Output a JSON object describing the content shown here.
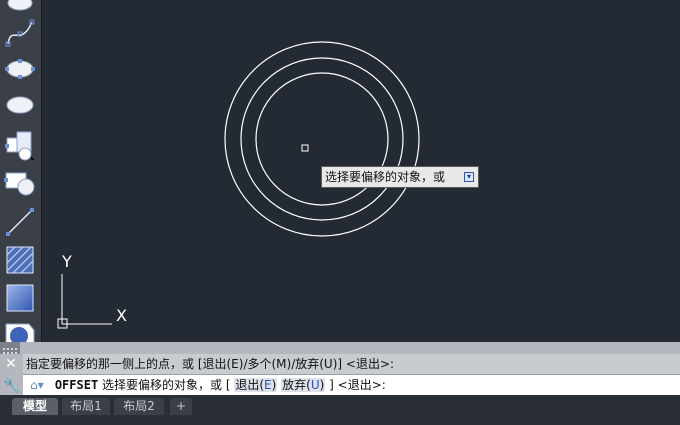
{
  "toolbar": {
    "tools": [
      {
        "name": "ellipse-icon"
      },
      {
        "name": "spline-icon"
      },
      {
        "name": "ellipse-grips-icon"
      },
      {
        "name": "ellipse-icon"
      },
      {
        "name": "region-icon"
      },
      {
        "name": "rectangle-circle-icon"
      },
      {
        "name": "line-icon"
      },
      {
        "name": "hatch-icon"
      },
      {
        "name": "gradient-icon"
      },
      {
        "name": "boundary-icon"
      }
    ]
  },
  "canvas": {
    "ucs": {
      "y_label": "Y",
      "x_label": "X"
    },
    "colors": {
      "background": "#242a33",
      "geometry": "#ffffff"
    }
  },
  "tooltip": {
    "text": "选择要偏移的对象，或",
    "icon": "expand-down-icon"
  },
  "command": {
    "history": "指定要偏移的那一侧上的点，或 [退出(E)/多个(M)/放弃(U)] <退出>:",
    "current": {
      "name": "OFFSET",
      "prompt": "选择要偏移的对象，或 [",
      "options": [
        {
          "label": "退出(",
          "key": "E",
          "close": ")"
        },
        {
          "label": "放弃(",
          "key": "U",
          "close": ")"
        }
      ],
      "suffix": "] <退出>:"
    }
  },
  "tabs": [
    {
      "label": "模型",
      "active": true
    },
    {
      "label": "布局1",
      "active": false
    },
    {
      "label": "布局2",
      "active": false
    },
    {
      "label": "+",
      "active": false
    }
  ]
}
